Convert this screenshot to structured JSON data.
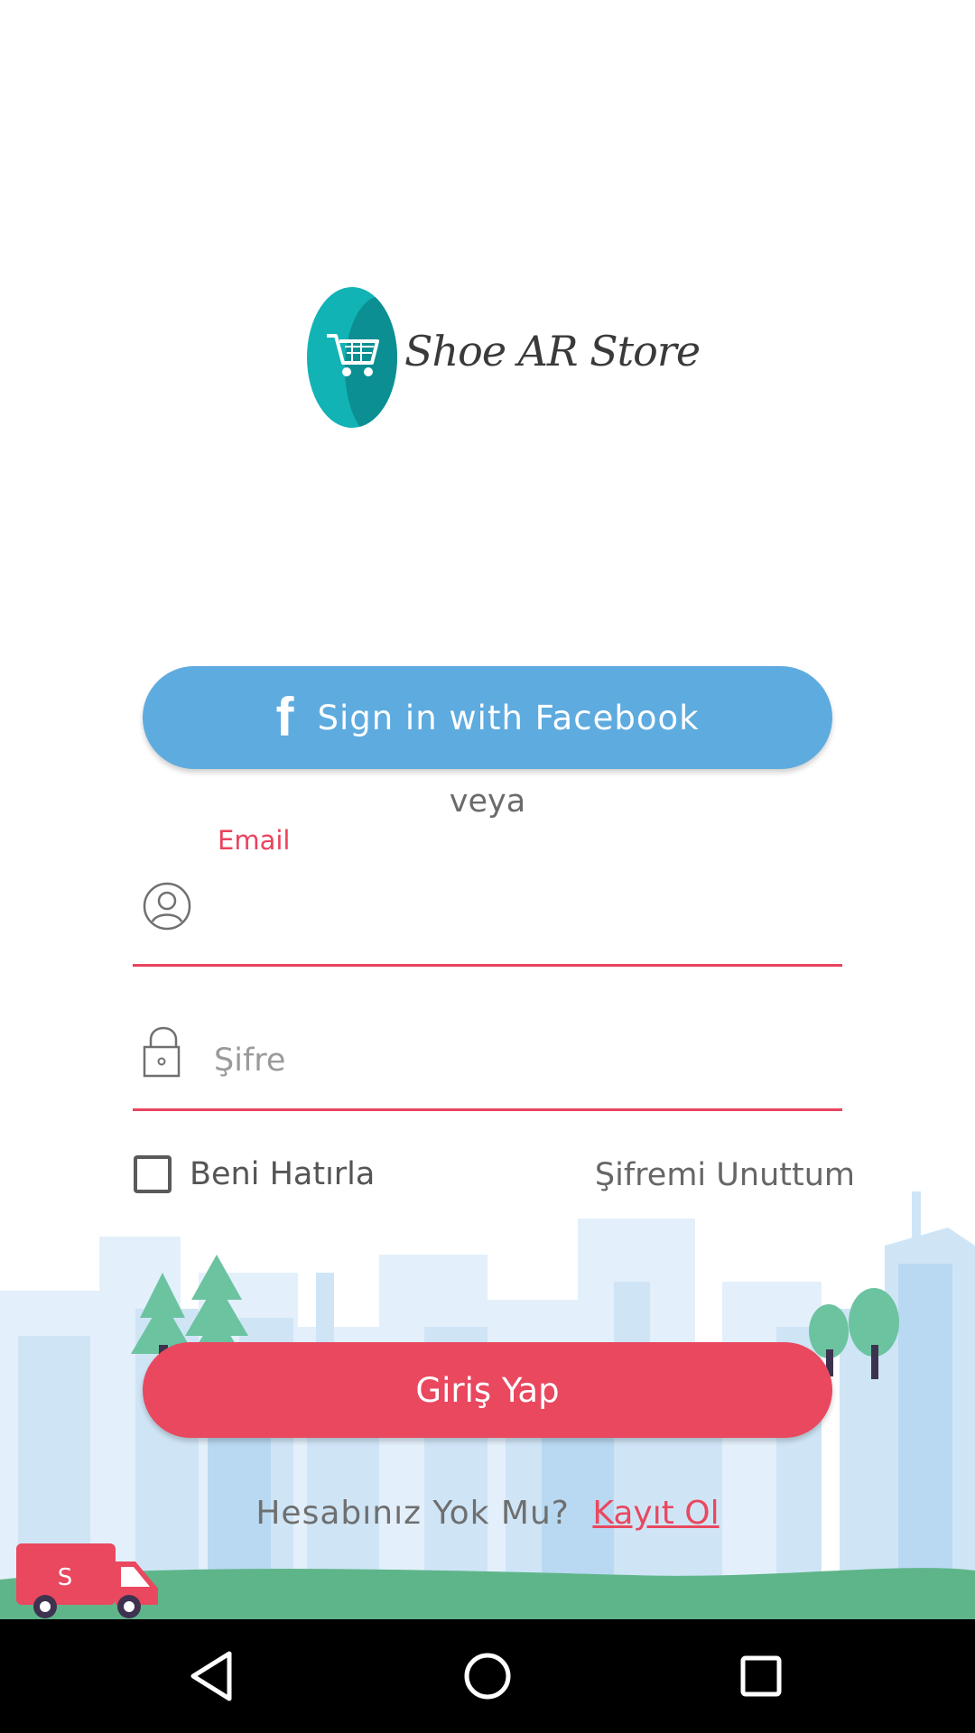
{
  "logo": {
    "text": "Shoe AR Store",
    "icon": "cart-icon"
  },
  "facebook_button": {
    "label": "Sign in with Facebook",
    "icon": "facebook-f-icon"
  },
  "separator": {
    "text": "veya"
  },
  "email_field": {
    "label": "Email",
    "value": "",
    "icon": "user-circle-icon"
  },
  "password_field": {
    "placeholder": "Şifre",
    "value": "",
    "icon": "lock-icon"
  },
  "remember_me": {
    "label": "Beni Hatırla",
    "checked": false
  },
  "forgot_password": {
    "label": "Şifremi Unuttum"
  },
  "login_button": {
    "label": "Giriş Yap"
  },
  "signup": {
    "question": "Hesabınız Yok Mu?",
    "link": "Kayıt Ol"
  },
  "colors": {
    "accent": "#e9485f",
    "facebook": "#5eabdf",
    "logo_teal": "#12b3b5",
    "city_light_blue": "#d7eaf8",
    "ground_green": "#5fb58a"
  },
  "nav": {
    "back_icon": "back-triangle-icon",
    "home_icon": "home-circle-icon",
    "recents_icon": "recents-square-icon"
  }
}
